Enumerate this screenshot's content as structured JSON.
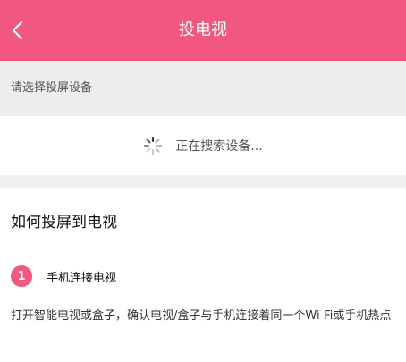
{
  "header": {
    "title": "投电视",
    "back_icon": "chevron-left-icon",
    "background_color": "#f2577f"
  },
  "device_list": {
    "label": "请选择投屏设备",
    "status_text": "正在搜索设备...",
    "status_icon": "loading-spinner-icon"
  },
  "guide": {
    "title": "如何投屏到电视",
    "steps": [
      {
        "number": "1",
        "title": "手机连接电视",
        "description": "打开智能电视或盒子，确认电视/盒子与手机连接着同一个Wi-Fi或手机热点"
      }
    ]
  }
}
